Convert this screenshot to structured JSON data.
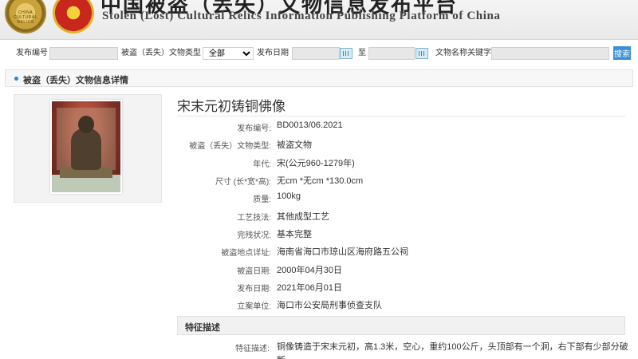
{
  "header": {
    "title_cn": "中国被盗（丢失）文物信息发布平台",
    "title_en": "Stolen (Lost) Cultural Relics Information Publishing Platform of China",
    "logo_left_text": "CHINA CULTURAL RELICS"
  },
  "search": {
    "id_label": "发布编号",
    "type_label": "被盗（丢失）文物类型",
    "type_selected": "全部",
    "date_label": "发布日期",
    "to_label": "至",
    "keyword_label": "文物名称关键字",
    "search_button": "搜索"
  },
  "panel": {
    "title": "被盗（丢失）文物信息详情"
  },
  "relic": {
    "name": "宋末元初铸铜佛像",
    "fields": [
      {
        "label": "发布编号:",
        "value": "BD0013/06.2021"
      },
      {
        "label": "被盗（丢失）文物类型:",
        "value": "被盗文物"
      },
      {
        "label": "年代:",
        "value": "宋(公元960-1279年)"
      },
      {
        "label": "尺寸 (长*宽*高):",
        "value": "无cm *无cm *130.0cm"
      },
      {
        "label": "质量:",
        "value": "100kg"
      },
      {
        "label": "工艺技法:",
        "value": "其他成型工艺"
      },
      {
        "label": "完残状况:",
        "value": "基本完整"
      },
      {
        "label": "被盗地点详址:",
        "value": "海南省海口市琼山区海府路五公祠"
      },
      {
        "label": "被盗日期:",
        "value": "2000年04月30日"
      },
      {
        "label": "发布日期:",
        "value": "2021年06月01日"
      },
      {
        "label": "立案单位:",
        "value": "海口市公安局刑事侦查支队"
      }
    ]
  },
  "features": {
    "title": "特征描述",
    "label": "特征描述:",
    "text": "铜像铸造于宋末元初，高1.3米，空心，重约100公斤，头顶部有一个洞，右下部有少部分破断"
  }
}
